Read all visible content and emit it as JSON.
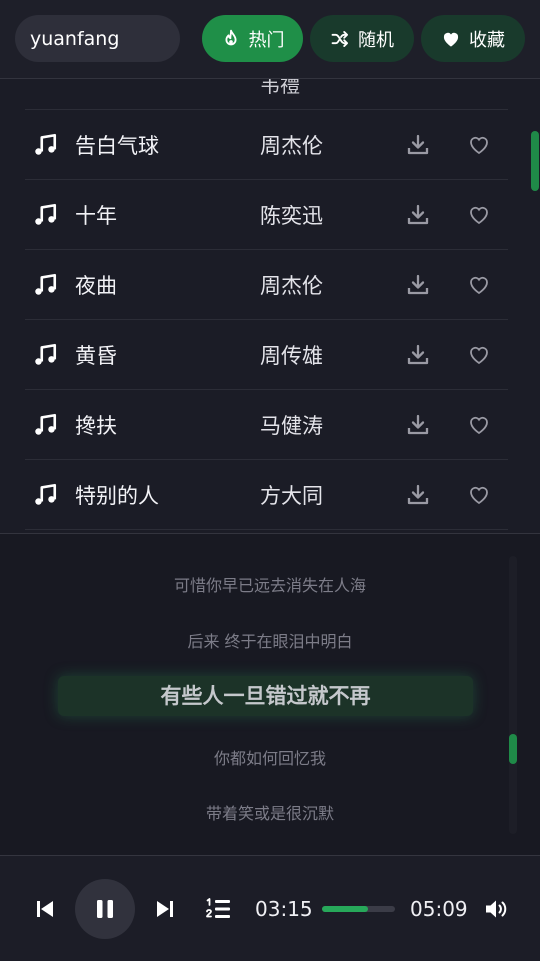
{
  "search": {
    "value": "yuanfang"
  },
  "tabs": {
    "hot_label": "热门",
    "random_label": "随机",
    "favorites_label": "收藏"
  },
  "song_list": {
    "partial_artist": "韦禮",
    "songs": [
      {
        "title": "告白气球",
        "artist": "周杰伦"
      },
      {
        "title": "十年",
        "artist": "陈奕迅"
      },
      {
        "title": "夜曲",
        "artist": "周杰伦"
      },
      {
        "title": "黄昏",
        "artist": "周传雄"
      },
      {
        "title": "搀扶",
        "artist": "马健涛"
      },
      {
        "title": "特别的人",
        "artist": "方大同"
      }
    ]
  },
  "lyrics": {
    "lines": [
      "可惜你早已远去消失在人海",
      "后来 终于在眼泪中明白",
      "有些人一旦错过就不再",
      "你都如何回忆我",
      "带着笑或是很沉默"
    ],
    "active_index": 2
  },
  "player": {
    "current_time": "03:15",
    "total_time": "05:09",
    "progress_fraction": 0.63
  },
  "colors": {
    "accent": "#1f8f48",
    "accent_dark": "#193a2c",
    "background": "#1b1c26"
  },
  "icons": {
    "hot": "flame-icon",
    "random": "shuffle-icon",
    "favorites": "heart-icon",
    "song": "music-note-icon",
    "download": "download-icon",
    "like": "heart-outline-icon",
    "prev": "skip-previous-icon",
    "pause": "pause-icon",
    "next": "skip-next-icon",
    "playlist": "playlist-icon",
    "volume": "volume-icon"
  }
}
